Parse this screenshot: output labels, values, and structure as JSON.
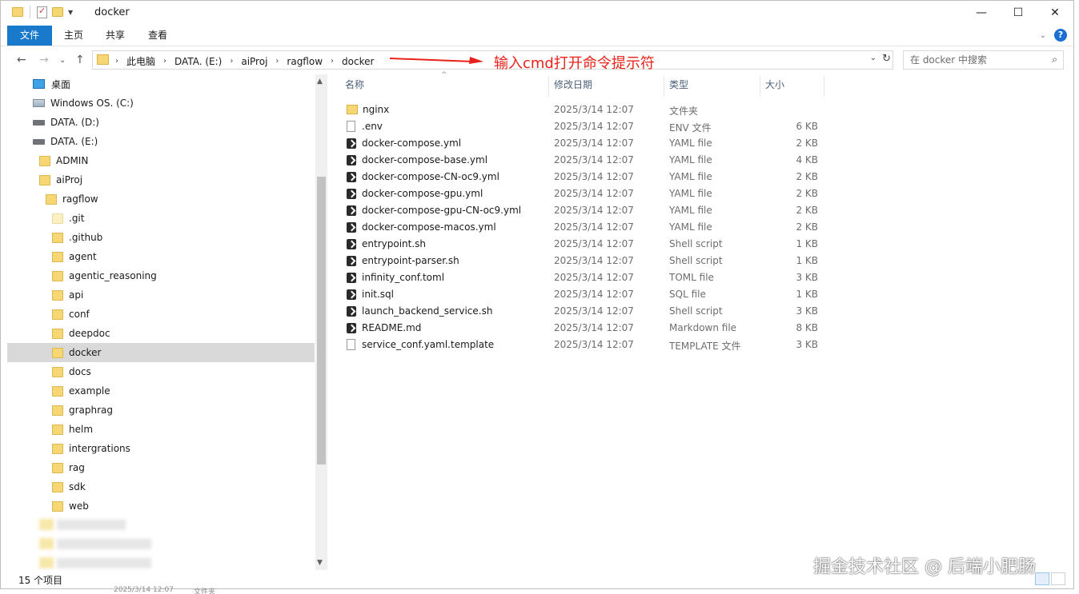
{
  "window": {
    "title": "docker",
    "controls": {
      "minimize": "—",
      "maximize": "☐",
      "close": "✕"
    }
  },
  "ribbon": {
    "tabs": [
      "文件",
      "主页",
      "共享",
      "查看"
    ],
    "help": "?"
  },
  "address": {
    "crumbs": [
      "此电脑",
      "DATA. (E:)",
      "aiProj",
      "ragflow",
      "docker"
    ],
    "annotation": "输入cmd打开命令提示符",
    "annotation_color": "#e8221a"
  },
  "search": {
    "placeholder": "在 docker 中搜索"
  },
  "nav": {
    "items": [
      {
        "label": "桌面",
        "icon": "desktop-icon"
      },
      {
        "label": "Windows OS. (C:)",
        "icon": "os-drive-icon"
      },
      {
        "label": "DATA. (D:)",
        "icon": "drive-icon"
      },
      {
        "label": "DATA. (E:)",
        "icon": "drive-icon"
      },
      {
        "label": "ADMIN",
        "icon": "folder-icon"
      },
      {
        "label": "aiProj",
        "icon": "folder-icon"
      },
      {
        "label": "ragflow",
        "icon": "folder-icon"
      },
      {
        "label": ".git",
        "icon": "folder-icon"
      },
      {
        "label": ".github",
        "icon": "folder-icon"
      },
      {
        "label": "agent",
        "icon": "folder-icon"
      },
      {
        "label": "agentic_reasoning",
        "icon": "folder-icon"
      },
      {
        "label": "api",
        "icon": "folder-icon"
      },
      {
        "label": "conf",
        "icon": "folder-icon"
      },
      {
        "label": "deepdoc",
        "icon": "folder-icon"
      },
      {
        "label": "docker",
        "icon": "folder-icon",
        "selected": true
      },
      {
        "label": "docs",
        "icon": "folder-icon"
      },
      {
        "label": "example",
        "icon": "folder-icon"
      },
      {
        "label": "graphrag",
        "icon": "folder-icon"
      },
      {
        "label": "helm",
        "icon": "folder-icon"
      },
      {
        "label": "intergrations",
        "icon": "folder-icon"
      },
      {
        "label": "rag",
        "icon": "folder-icon"
      },
      {
        "label": "sdk",
        "icon": "folder-icon"
      },
      {
        "label": "web",
        "icon": "folder-icon"
      }
    ]
  },
  "columns": {
    "name": "名称",
    "date": "修改日期",
    "type": "类型",
    "size": "大小"
  },
  "files": [
    {
      "name": "nginx",
      "date": "2025/3/14 12:07",
      "type": "文件夹",
      "size": "",
      "icon": "folder-icon"
    },
    {
      "name": ".env",
      "date": "2025/3/14 12:07",
      "type": "ENV 文件",
      "size": "6 KB",
      "icon": "file-icon"
    },
    {
      "name": "docker-compose.yml",
      "date": "2025/3/14 12:07",
      "type": "YAML file",
      "size": "2 KB",
      "icon": "script-icon"
    },
    {
      "name": "docker-compose-base.yml",
      "date": "2025/3/14 12:07",
      "type": "YAML file",
      "size": "4 KB",
      "icon": "script-icon"
    },
    {
      "name": "docker-compose-CN-oc9.yml",
      "date": "2025/3/14 12:07",
      "type": "YAML file",
      "size": "2 KB",
      "icon": "script-icon"
    },
    {
      "name": "docker-compose-gpu.yml",
      "date": "2025/3/14 12:07",
      "type": "YAML file",
      "size": "2 KB",
      "icon": "script-icon"
    },
    {
      "name": "docker-compose-gpu-CN-oc9.yml",
      "date": "2025/3/14 12:07",
      "type": "YAML file",
      "size": "2 KB",
      "icon": "script-icon"
    },
    {
      "name": "docker-compose-macos.yml",
      "date": "2025/3/14 12:07",
      "type": "YAML file",
      "size": "2 KB",
      "icon": "script-icon"
    },
    {
      "name": "entrypoint.sh",
      "date": "2025/3/14 12:07",
      "type": "Shell script",
      "size": "1 KB",
      "icon": "script-icon"
    },
    {
      "name": "entrypoint-parser.sh",
      "date": "2025/3/14 12:07",
      "type": "Shell script",
      "size": "1 KB",
      "icon": "script-icon"
    },
    {
      "name": "infinity_conf.toml",
      "date": "2025/3/14 12:07",
      "type": "TOML file",
      "size": "3 KB",
      "icon": "script-icon"
    },
    {
      "name": "init.sql",
      "date": "2025/3/14 12:07",
      "type": "SQL file",
      "size": "1 KB",
      "icon": "script-icon"
    },
    {
      "name": "launch_backend_service.sh",
      "date": "2025/3/14 12:07",
      "type": "Shell script",
      "size": "3 KB",
      "icon": "script-icon"
    },
    {
      "name": "README.md",
      "date": "2025/3/14 12:07",
      "type": "Markdown file",
      "size": "8 KB",
      "icon": "script-icon"
    },
    {
      "name": "service_conf.yaml.template",
      "date": "2025/3/14 12:07",
      "type": "TEMPLATE 文件",
      "size": "3 KB",
      "icon": "file-icon"
    }
  ],
  "status": {
    "count": "15 个项目"
  },
  "watermark": "掘金技术社区 @ 后端小肥肠",
  "background_ghost": {
    "date": "2025/3/14 12:07",
    "type": "文件夹"
  }
}
